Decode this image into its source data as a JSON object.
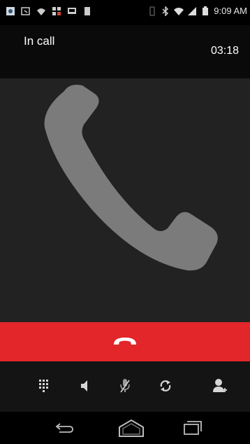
{
  "status_bar": {
    "time": "9:09 AM",
    "icons": [
      "photo-icon",
      "email-icon",
      "wifi-icon",
      "bbm-icon",
      "screen-icon",
      "battery-small-icon",
      "vibrate-icon",
      "bluetooth-icon",
      "wifi-signal-icon",
      "battery-icon"
    ]
  },
  "call": {
    "status": "In call",
    "timer": "03:18"
  },
  "photo": {
    "placeholder_icon": "phone-handset-icon"
  },
  "end_call": {
    "icon": "hang-up-icon",
    "color": "#e3262a"
  },
  "controls": [
    {
      "name": "dialpad",
      "icon": "dialpad-icon"
    },
    {
      "name": "speaker",
      "icon": "speaker-icon"
    },
    {
      "name": "mute",
      "icon": "mute-mic-icon"
    },
    {
      "name": "swap",
      "icon": "swap-icon"
    },
    {
      "name": "add-call",
      "icon": "add-call-icon"
    }
  ],
  "nav": [
    {
      "name": "back",
      "icon": "back-icon"
    },
    {
      "name": "home",
      "icon": "home-icon"
    },
    {
      "name": "recent-apps",
      "icon": "recent-apps-icon"
    }
  ]
}
